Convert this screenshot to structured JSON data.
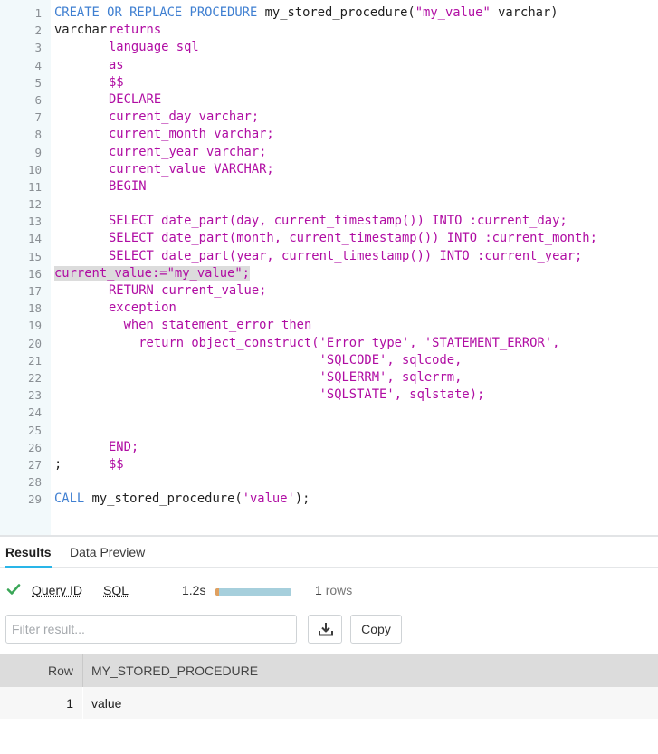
{
  "editor": {
    "lines": [
      {
        "n": "1",
        "t": [
          [
            "kw",
            "CREATE OR REPLACE PROCEDURE "
          ],
          [
            "id",
            "my_stored_procedure"
          ],
          [
            "id",
            "("
          ],
          [
            "str",
            "\"my_value\""
          ],
          [
            "id",
            " varchar)"
          ]
        ]
      },
      {
        "n": "2",
        "t": [
          [
            "code",
            "returns "
          ],
          [
            "id",
            "varchar"
          ]
        ]
      },
      {
        "n": "3",
        "t": [
          [
            "code",
            "language sql"
          ]
        ]
      },
      {
        "n": "4",
        "t": [
          [
            "code",
            "as"
          ]
        ]
      },
      {
        "n": "5",
        "t": [
          [
            "code",
            "$$"
          ]
        ]
      },
      {
        "n": "6",
        "t": [
          [
            "code",
            "DECLARE"
          ]
        ]
      },
      {
        "n": "7",
        "t": [
          [
            "code",
            "current_day varchar;"
          ]
        ]
      },
      {
        "n": "8",
        "t": [
          [
            "code",
            "current_month varchar;"
          ]
        ]
      },
      {
        "n": "9",
        "t": [
          [
            "code",
            "current_year varchar;"
          ]
        ]
      },
      {
        "n": "10",
        "t": [
          [
            "code",
            "current_value VARCHAR;"
          ]
        ]
      },
      {
        "n": "11",
        "t": [
          [
            "code",
            "BEGIN"
          ]
        ]
      },
      {
        "n": "12",
        "t": [
          [
            "code",
            ""
          ]
        ]
      },
      {
        "n": "13",
        "t": [
          [
            "code",
            "SELECT date_part(day, current_timestamp()) INTO :current_day;"
          ]
        ]
      },
      {
        "n": "14",
        "t": [
          [
            "code",
            "SELECT date_part(month, current_timestamp()) INTO :current_month;"
          ]
        ]
      },
      {
        "n": "15",
        "t": [
          [
            "code",
            "SELECT date_part(year, current_timestamp()) INTO :current_year;"
          ]
        ]
      },
      {
        "n": "16",
        "t": [
          [
            "hl",
            "current_value:=\"my_value\";"
          ]
        ]
      },
      {
        "n": "17",
        "t": [
          [
            "code",
            "RETURN current_value;"
          ]
        ]
      },
      {
        "n": "18",
        "t": [
          [
            "code",
            "exception"
          ]
        ]
      },
      {
        "n": "19",
        "t": [
          [
            "code",
            "  when statement_error then"
          ]
        ]
      },
      {
        "n": "20",
        "t": [
          [
            "code",
            "    return object_construct('Error type', 'STATEMENT_ERROR',"
          ]
        ]
      },
      {
        "n": "21",
        "t": [
          [
            "code",
            "                            'SQLCODE', sqlcode,"
          ]
        ]
      },
      {
        "n": "22",
        "t": [
          [
            "code",
            "                            'SQLERRM', sqlerrm,"
          ]
        ]
      },
      {
        "n": "23",
        "t": [
          [
            "code",
            "                            'SQLSTATE', sqlstate);"
          ]
        ]
      },
      {
        "n": "24",
        "t": [
          [
            "code",
            ""
          ]
        ]
      },
      {
        "n": "25",
        "t": [
          [
            "code",
            ""
          ]
        ]
      },
      {
        "n": "26",
        "t": [
          [
            "code",
            "END;"
          ]
        ]
      },
      {
        "n": "27",
        "t": [
          [
            "code",
            "$$"
          ],
          [
            "id",
            ";"
          ]
        ]
      },
      {
        "n": "28",
        "t": [
          [
            "code",
            ""
          ]
        ]
      },
      {
        "n": "29",
        "t": [
          [
            "kw",
            "CALL "
          ],
          [
            "id",
            "my_stored_procedure("
          ],
          [
            "str",
            "'value'"
          ],
          [
            "id",
            ");"
          ]
        ]
      }
    ]
  },
  "tabs": {
    "results": "Results",
    "data_preview": "Data Preview"
  },
  "status": {
    "query_id": "Query ID",
    "sql": "SQL",
    "duration": "1.2s",
    "row_count": "1",
    "row_unit": "rows"
  },
  "filter": {
    "placeholder": "Filter result..."
  },
  "toolbar": {
    "copy_label": "Copy",
    "download_icon": "download-icon"
  },
  "table": {
    "columns": [
      "Row",
      "MY_STORED_PROCEDURE"
    ],
    "rows": [
      {
        "row": "1",
        "value": "value"
      }
    ]
  },
  "colors": {
    "keyword": "#3f7fd1",
    "code": "#b00da3",
    "accent": "#29b5e8",
    "success": "#3aa657"
  }
}
